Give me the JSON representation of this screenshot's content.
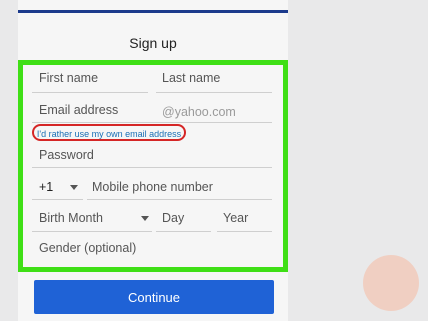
{
  "form": {
    "title": "Sign up",
    "first_name_placeholder": "First name",
    "last_name_placeholder": "Last name",
    "email_placeholder": "Email address",
    "email_domain": "@yahoo.com",
    "own_email_link": "I'd rather use my own email address",
    "password_placeholder": "Password",
    "country_code": "+1",
    "mobile_placeholder": "Mobile phone number",
    "birth_month_placeholder": "Birth Month",
    "day_placeholder": "Day",
    "year_placeholder": "Year",
    "gender_placeholder": "Gender (optional)",
    "continue_label": "Continue"
  },
  "colors": {
    "highlight_green": "#3fdf16",
    "highlight_red": "#d52626",
    "button_blue": "#1f62d6",
    "top_bar": "#1b3a8c"
  },
  "icons": {
    "country_dropdown": "chevron-down-icon",
    "month_dropdown": "chevron-down-icon"
  }
}
